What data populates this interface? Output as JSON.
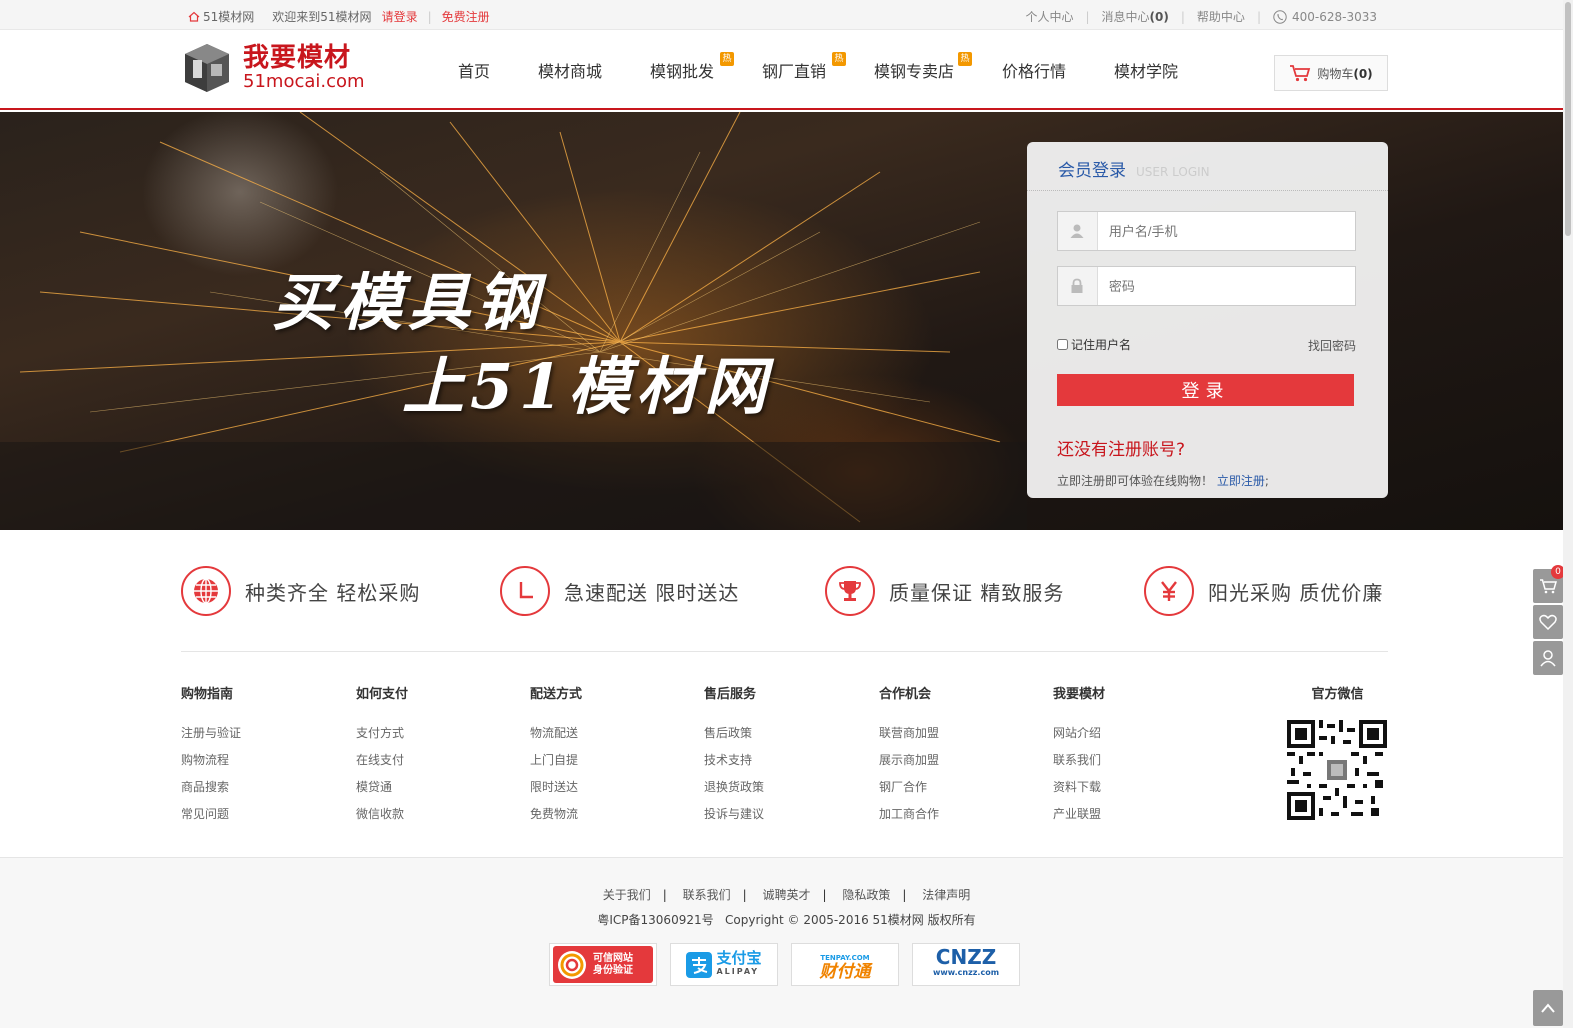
{
  "topbar": {
    "site_name": "51模材网",
    "welcome": "欢迎来到51模材网",
    "login": "请登录",
    "register": "免费注册",
    "user_center": "个人中心",
    "message_center": "消息中心",
    "message_count": "(0)",
    "help_center": "帮助中心",
    "phone": "400-628-3033"
  },
  "header": {
    "logo_cn": "我要模材",
    "logo_en": "51mocai.com",
    "nav": [
      {
        "label": "首页",
        "hot": false
      },
      {
        "label": "模材商城",
        "hot": false
      },
      {
        "label": "模钢批发",
        "hot": true
      },
      {
        "label": "钢厂直销",
        "hot": true
      },
      {
        "label": "模钢专卖店",
        "hot": true
      },
      {
        "label": "价格行情",
        "hot": false
      },
      {
        "label": "模材学院",
        "hot": false
      }
    ],
    "hot_badge": "热",
    "cart_label": "购物车",
    "cart_count": "(0)"
  },
  "banner": {
    "slogan_line1": "买模具钢",
    "slogan_line2": "上51模材网"
  },
  "login": {
    "title": "会员登录",
    "title_en": "USER LOGIN",
    "username_placeholder": "用户名/手机",
    "password_placeholder": "密码",
    "remember": "记住用户名",
    "forgot": "找回密码",
    "submit": "登录",
    "no_account": "还没有注册账号?",
    "register_tip": "立即注册即可体验在线购物！",
    "register_link": "立即注册",
    "register_suffix": ";"
  },
  "features": [
    {
      "icon": "globe-icon",
      "text": "种类齐全 轻松采购"
    },
    {
      "icon": "clock-icon",
      "text": "急速配送 限时送达"
    },
    {
      "icon": "trophy-icon",
      "text": "质量保证 精致服务"
    },
    {
      "icon": "yen-icon",
      "text": "阳光采购 质优价廉"
    }
  ],
  "footer_cols": [
    {
      "title": "购物指南",
      "links": [
        "注册与验证",
        "购物流程",
        "商品搜索",
        "常见问题"
      ]
    },
    {
      "title": "如何支付",
      "links": [
        "支付方式",
        "在线支付",
        "模贷通",
        "微信收款"
      ]
    },
    {
      "title": "配送方式",
      "links": [
        "物流配送",
        "上门自提",
        "限时送达",
        "免费物流"
      ]
    },
    {
      "title": "售后服务",
      "links": [
        "售后政策",
        "技术支持",
        "退换货政策",
        "投诉与建议"
      ]
    },
    {
      "title": "合作机会",
      "links": [
        "联营商加盟",
        "展示商加盟",
        "钢厂合作",
        "加工商合作"
      ]
    },
    {
      "title": "我要模材",
      "links": [
        "网站介绍",
        "联系我们",
        "资料下载",
        "产业联盟"
      ]
    }
  ],
  "wechat_title": "官方微信",
  "bottom_links": [
    "关于我们",
    "联系我们",
    "诚聘英才",
    "隐私政策",
    "法律声明"
  ],
  "copyright": "粤ICP备13060921号   Copyright © 2005-2016 51模材网 版权所有",
  "badges": [
    {
      "name": "trusted-site-badge",
      "line1": "可信网站",
      "line2": "身份验证"
    },
    {
      "name": "alipay-badge",
      "line1": "支付宝",
      "line2": "ALIPAY"
    },
    {
      "name": "tenpay-badge",
      "line1": "财付通",
      "line2": "TENPAY.COM"
    },
    {
      "name": "cnzz-badge",
      "line1": "CNZZ",
      "line2": "www.cnzz.com"
    }
  ],
  "side": {
    "cart_count": "0"
  },
  "colors": {
    "accent": "#e4393c",
    "brand": "#c8161d",
    "link_blue": "#2a5aa8"
  }
}
